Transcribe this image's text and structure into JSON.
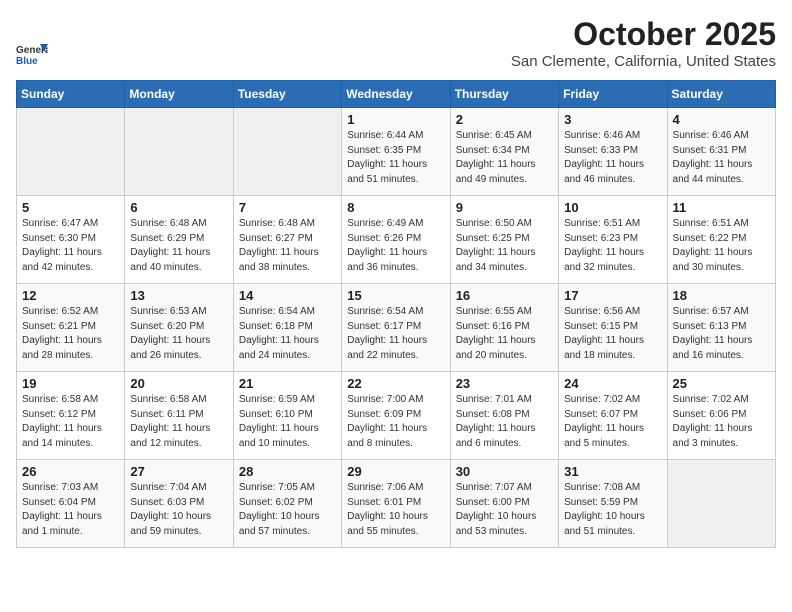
{
  "header": {
    "logo_general": "General",
    "logo_blue": "Blue",
    "month_title": "October 2025",
    "location": "San Clemente, California, United States"
  },
  "days_of_week": [
    "Sunday",
    "Monday",
    "Tuesday",
    "Wednesday",
    "Thursday",
    "Friday",
    "Saturday"
  ],
  "weeks": [
    [
      {
        "day": "",
        "info": ""
      },
      {
        "day": "",
        "info": ""
      },
      {
        "day": "",
        "info": ""
      },
      {
        "day": "1",
        "info": "Sunrise: 6:44 AM\nSunset: 6:35 PM\nDaylight: 11 hours\nand 51 minutes."
      },
      {
        "day": "2",
        "info": "Sunrise: 6:45 AM\nSunset: 6:34 PM\nDaylight: 11 hours\nand 49 minutes."
      },
      {
        "day": "3",
        "info": "Sunrise: 6:46 AM\nSunset: 6:33 PM\nDaylight: 11 hours\nand 46 minutes."
      },
      {
        "day": "4",
        "info": "Sunrise: 6:46 AM\nSunset: 6:31 PM\nDaylight: 11 hours\nand 44 minutes."
      }
    ],
    [
      {
        "day": "5",
        "info": "Sunrise: 6:47 AM\nSunset: 6:30 PM\nDaylight: 11 hours\nand 42 minutes."
      },
      {
        "day": "6",
        "info": "Sunrise: 6:48 AM\nSunset: 6:29 PM\nDaylight: 11 hours\nand 40 minutes."
      },
      {
        "day": "7",
        "info": "Sunrise: 6:48 AM\nSunset: 6:27 PM\nDaylight: 11 hours\nand 38 minutes."
      },
      {
        "day": "8",
        "info": "Sunrise: 6:49 AM\nSunset: 6:26 PM\nDaylight: 11 hours\nand 36 minutes."
      },
      {
        "day": "9",
        "info": "Sunrise: 6:50 AM\nSunset: 6:25 PM\nDaylight: 11 hours\nand 34 minutes."
      },
      {
        "day": "10",
        "info": "Sunrise: 6:51 AM\nSunset: 6:23 PM\nDaylight: 11 hours\nand 32 minutes."
      },
      {
        "day": "11",
        "info": "Sunrise: 6:51 AM\nSunset: 6:22 PM\nDaylight: 11 hours\nand 30 minutes."
      }
    ],
    [
      {
        "day": "12",
        "info": "Sunrise: 6:52 AM\nSunset: 6:21 PM\nDaylight: 11 hours\nand 28 minutes."
      },
      {
        "day": "13",
        "info": "Sunrise: 6:53 AM\nSunset: 6:20 PM\nDaylight: 11 hours\nand 26 minutes."
      },
      {
        "day": "14",
        "info": "Sunrise: 6:54 AM\nSunset: 6:18 PM\nDaylight: 11 hours\nand 24 minutes."
      },
      {
        "day": "15",
        "info": "Sunrise: 6:54 AM\nSunset: 6:17 PM\nDaylight: 11 hours\nand 22 minutes."
      },
      {
        "day": "16",
        "info": "Sunrise: 6:55 AM\nSunset: 6:16 PM\nDaylight: 11 hours\nand 20 minutes."
      },
      {
        "day": "17",
        "info": "Sunrise: 6:56 AM\nSunset: 6:15 PM\nDaylight: 11 hours\nand 18 minutes."
      },
      {
        "day": "18",
        "info": "Sunrise: 6:57 AM\nSunset: 6:13 PM\nDaylight: 11 hours\nand 16 minutes."
      }
    ],
    [
      {
        "day": "19",
        "info": "Sunrise: 6:58 AM\nSunset: 6:12 PM\nDaylight: 11 hours\nand 14 minutes."
      },
      {
        "day": "20",
        "info": "Sunrise: 6:58 AM\nSunset: 6:11 PM\nDaylight: 11 hours\nand 12 minutes."
      },
      {
        "day": "21",
        "info": "Sunrise: 6:59 AM\nSunset: 6:10 PM\nDaylight: 11 hours\nand 10 minutes."
      },
      {
        "day": "22",
        "info": "Sunrise: 7:00 AM\nSunset: 6:09 PM\nDaylight: 11 hours\nand 8 minutes."
      },
      {
        "day": "23",
        "info": "Sunrise: 7:01 AM\nSunset: 6:08 PM\nDaylight: 11 hours\nand 6 minutes."
      },
      {
        "day": "24",
        "info": "Sunrise: 7:02 AM\nSunset: 6:07 PM\nDaylight: 11 hours\nand 5 minutes."
      },
      {
        "day": "25",
        "info": "Sunrise: 7:02 AM\nSunset: 6:06 PM\nDaylight: 11 hours\nand 3 minutes."
      }
    ],
    [
      {
        "day": "26",
        "info": "Sunrise: 7:03 AM\nSunset: 6:04 PM\nDaylight: 11 hours\nand 1 minute."
      },
      {
        "day": "27",
        "info": "Sunrise: 7:04 AM\nSunset: 6:03 PM\nDaylight: 10 hours\nand 59 minutes."
      },
      {
        "day": "28",
        "info": "Sunrise: 7:05 AM\nSunset: 6:02 PM\nDaylight: 10 hours\nand 57 minutes."
      },
      {
        "day": "29",
        "info": "Sunrise: 7:06 AM\nSunset: 6:01 PM\nDaylight: 10 hours\nand 55 minutes."
      },
      {
        "day": "30",
        "info": "Sunrise: 7:07 AM\nSunset: 6:00 PM\nDaylight: 10 hours\nand 53 minutes."
      },
      {
        "day": "31",
        "info": "Sunrise: 7:08 AM\nSunset: 5:59 PM\nDaylight: 10 hours\nand 51 minutes."
      },
      {
        "day": "",
        "info": ""
      }
    ]
  ]
}
